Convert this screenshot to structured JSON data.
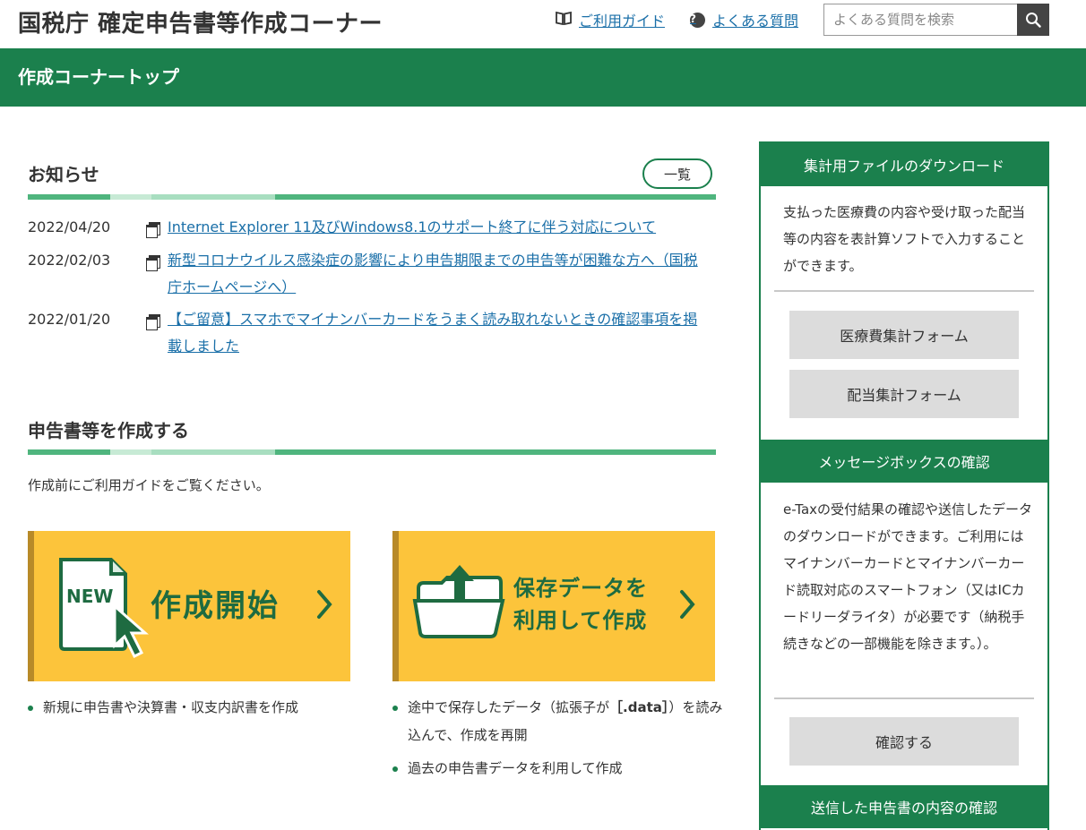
{
  "header": {
    "site_title": "国税庁 確定申告書等作成コーナー",
    "guide_link": "ご利用ガイド",
    "faq_link": "よくある質問",
    "search_placeholder": "よくある質問を検索",
    "help_icon_glyph": "?"
  },
  "page_bar": {
    "title": "作成コーナートップ"
  },
  "news": {
    "heading": "お知らせ",
    "list_button": "一覧",
    "items": [
      {
        "date": "2022/04/20",
        "text": "Internet Explorer 11及びWindows8.1のサポート終了に伴う対応について"
      },
      {
        "date": "2022/02/03",
        "text": "新型コロナウイルス感染症の影響により申告期限までの申告等が困難な方へ（国税庁ホームページへ）"
      },
      {
        "date": "2022/01/20",
        "text": "【ご留意】スマホでマイナンバーカードをうまく読み取れないときの確認事項を掲載しました"
      }
    ]
  },
  "create": {
    "heading": "申告書等を作成する",
    "intro": "作成前にご利用ガイドをご覧ください。",
    "card_new": {
      "icon_text": "NEW",
      "label": "作成開始"
    },
    "card_saved": {
      "label_line1": "保存データを",
      "label_line2": "利用して作成"
    },
    "new_bullets": [
      "新規に申告書や決算書・収支内訳書を作成"
    ],
    "saved_bullets": {
      "b1_prefix": "途中で保存したデータ（拡張子が",
      "b1_bold": "［.data］",
      "b1_suffix": "）を読み込んで、作成を再開",
      "b2": "過去の申告書データを利用して作成"
    }
  },
  "sidebar": {
    "download": {
      "heading": "集計用ファイルのダウンロード",
      "text": "支払った医療費の内容や受け取った配当等の内容を表計算ソフトで入力することができます。",
      "btn_medical": "医療費集計フォーム",
      "btn_dividend": "配当集計フォーム"
    },
    "messagebox": {
      "heading": "メッセージボックスの確認",
      "text": "e-Taxの受付結果の確認や送信したデータのダウンロードができます。ご利用にはマイナンバーカードとマイナンバーカード読取対応のスマートフォン（又はICカードリーダライタ）が必要です（納税手続きなどの一部機能を除きます。）。",
      "btn_confirm": "確認する"
    },
    "sent": {
      "heading": "送信した申告書の内容の確認"
    }
  },
  "colors": {
    "brand_green": "#1b804d",
    "card_yellow": "#fcc43b",
    "link_blue": "#1a6fa8"
  }
}
